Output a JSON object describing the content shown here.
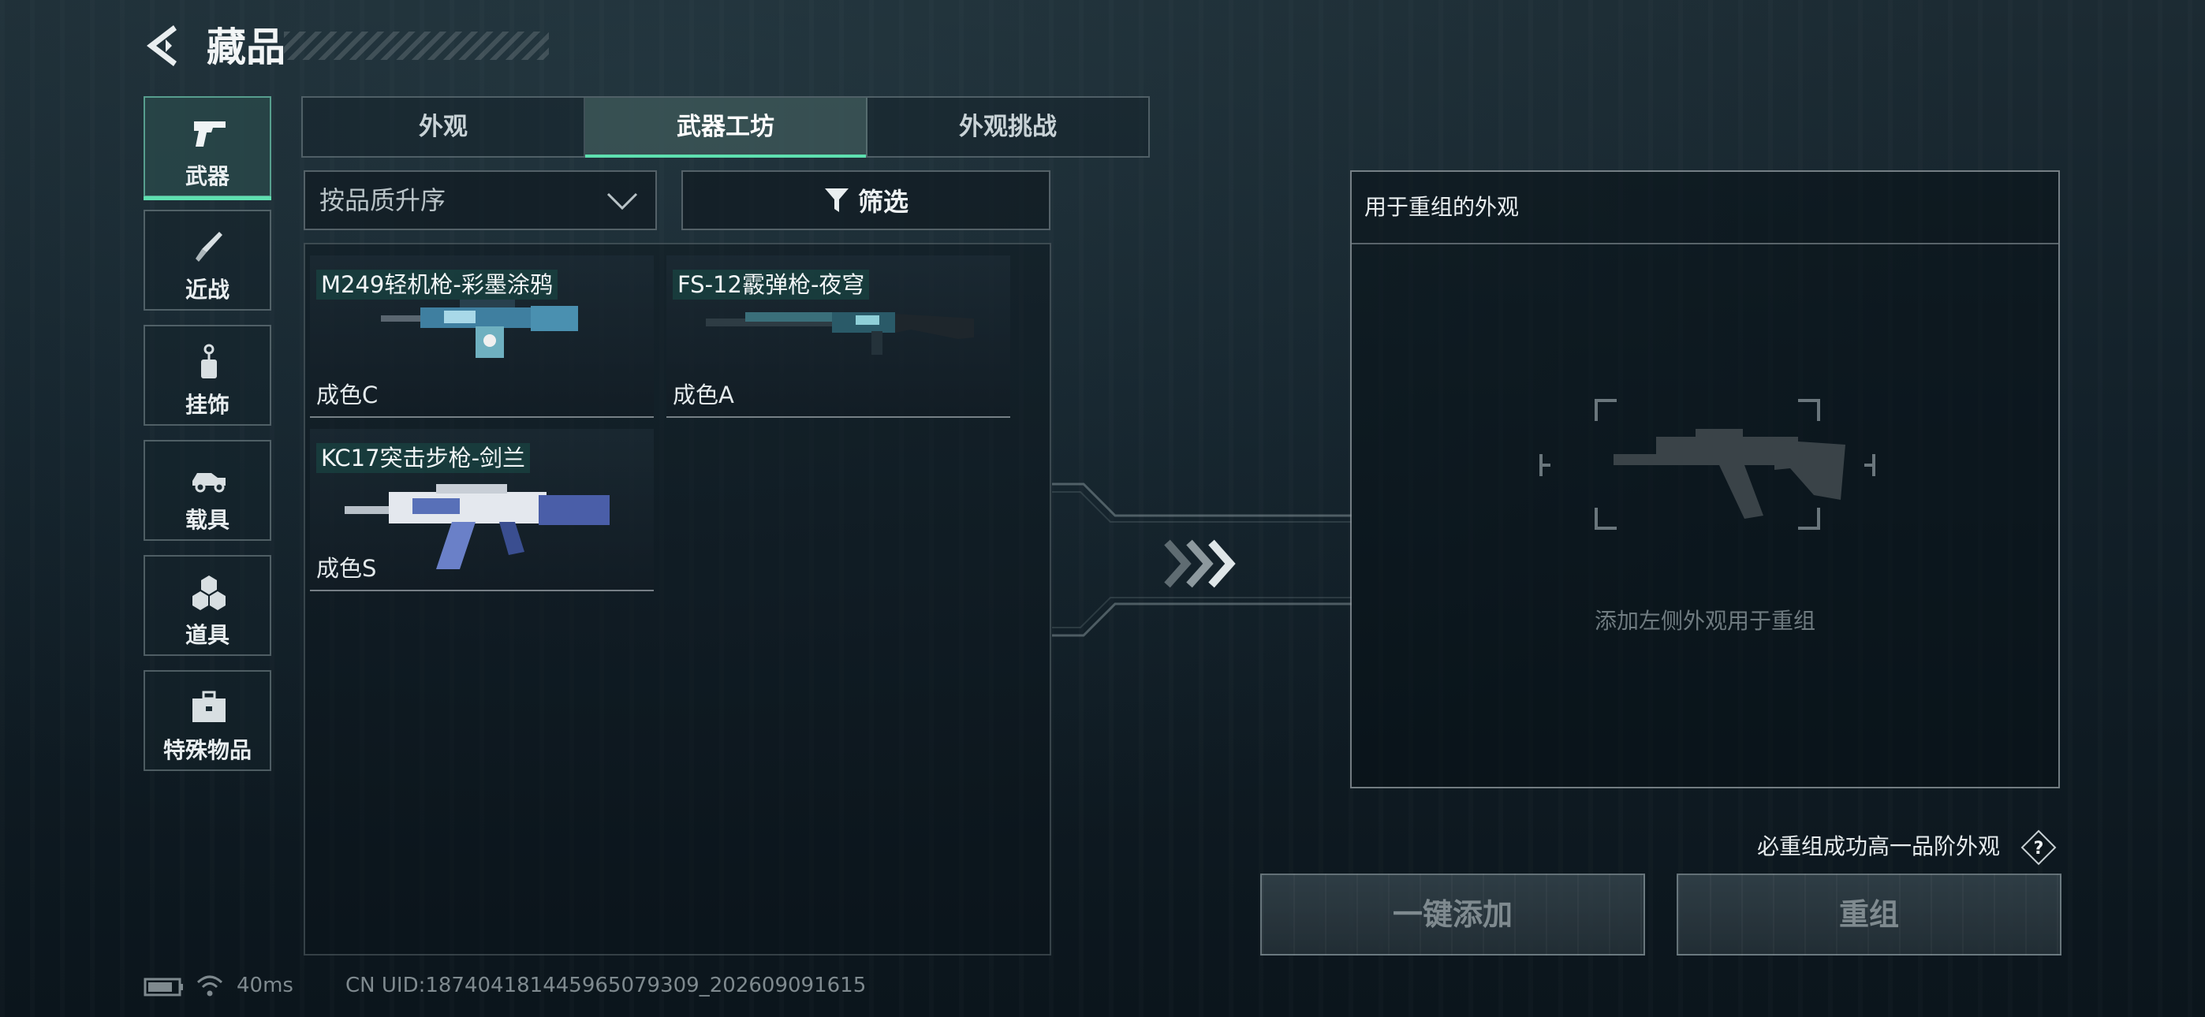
{
  "header": {
    "title": "藏品"
  },
  "sidebar": {
    "items": [
      {
        "label": "武器",
        "icon": "pistol-icon",
        "active": true
      },
      {
        "label": "近战",
        "icon": "knife-icon",
        "active": false
      },
      {
        "label": "挂饰",
        "icon": "charm-icon",
        "active": false
      },
      {
        "label": "载具",
        "icon": "vehicle-icon",
        "active": false
      },
      {
        "label": "道具",
        "icon": "cubes-icon",
        "active": false
      },
      {
        "label": "特殊物品",
        "icon": "briefcase-icon",
        "active": false
      }
    ]
  },
  "tabs": [
    {
      "label": "外观",
      "active": false
    },
    {
      "label": "武器工坊",
      "active": true
    },
    {
      "label": "外观挑战",
      "active": false
    }
  ],
  "sort": {
    "value": "按品质升序"
  },
  "filter": {
    "label": "筛选"
  },
  "items": [
    {
      "name": "M249轻机枪-彩墨涂鸦",
      "grade": "成色C"
    },
    {
      "name": "FS-12霰弹枪-夜穹",
      "grade": "成色A"
    },
    {
      "name": "KC17突击步枪-剑兰",
      "grade": "成色S"
    }
  ],
  "reroll": {
    "title": "用于重组的外观",
    "placeholder": "添加左侧外观用于重组"
  },
  "guarantee": {
    "text": "必重组成功高一品阶外观"
  },
  "buttons": {
    "add_all": "一键添加",
    "reroll": "重组"
  },
  "status": {
    "ping": "40ms",
    "uid": "CN UID:187404181445965079309_202609091615"
  },
  "colors": {
    "accent": "#5ee0b0",
    "disabled_text": "#7f8a8f"
  }
}
